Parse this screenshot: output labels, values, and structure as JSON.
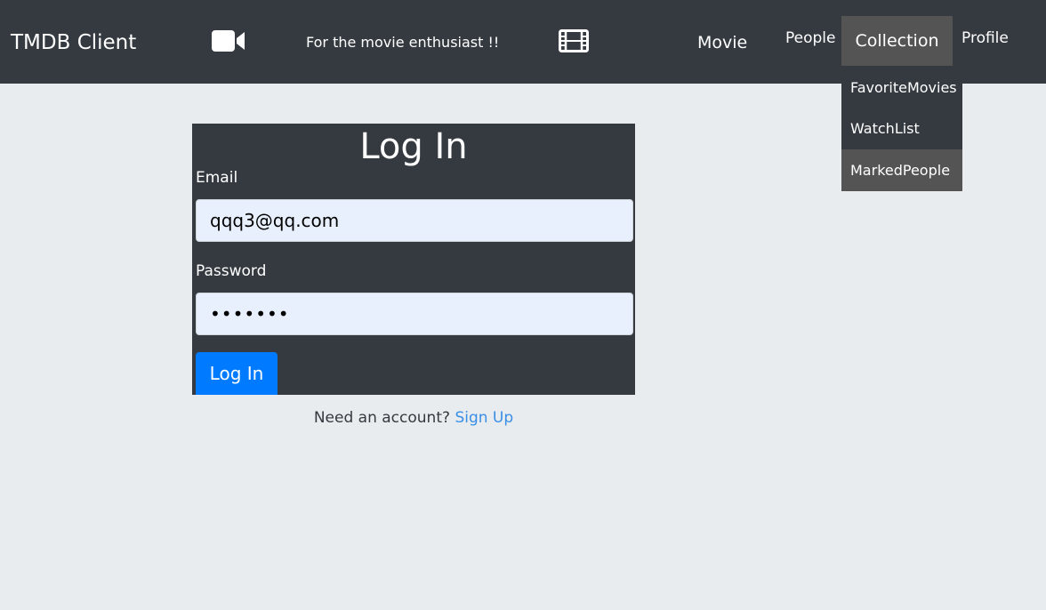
{
  "navbar": {
    "brand": "TMDB Client",
    "tagline": "For the movie enthusiast !!",
    "icons": [
      "video-camera-icon",
      "film-icon"
    ],
    "links": {
      "movie": "Movie",
      "people": "People",
      "collection": "Collection",
      "profile": "Profile"
    }
  },
  "collection_dropdown": {
    "items": [
      {
        "label": "FavoriteMovies"
      },
      {
        "label": "WatchList"
      },
      {
        "label": "MarkedPeople",
        "hovered": true
      }
    ]
  },
  "login": {
    "title": "Log In",
    "email_label": "Email",
    "email_value": "qqq3@qq.com",
    "password_label": "Password",
    "password_value": "•••••••",
    "submit_label": "Log In"
  },
  "signup": {
    "prompt": "Need an account?",
    "link_label": "Sign Up"
  },
  "colors": {
    "navbar_bg": "#343a40",
    "page_bg": "#e8ecef",
    "active_bg": "#545454",
    "primary": "#007bff",
    "link": "#3a8ee6",
    "input_bg": "#e8f0fe"
  }
}
